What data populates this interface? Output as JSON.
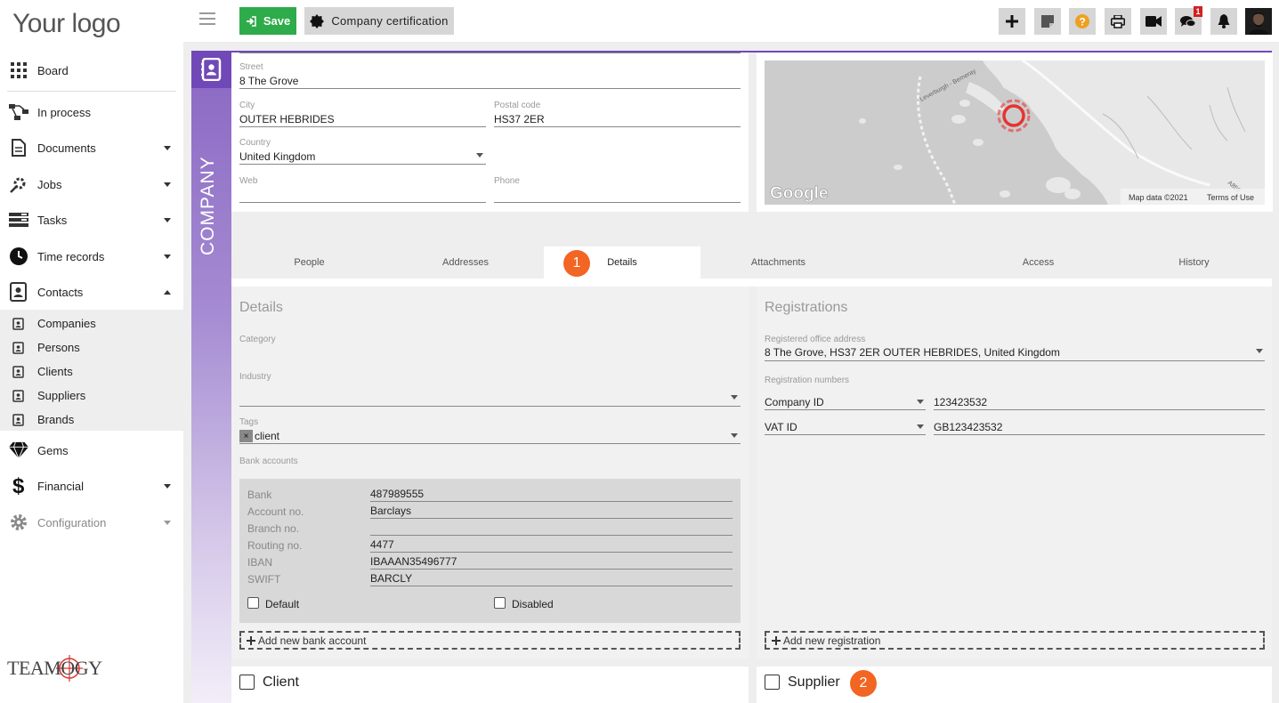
{
  "sidebar": {
    "logo": "Your logo",
    "items": [
      {
        "label": "Board"
      },
      {
        "label": "In process"
      },
      {
        "label": "Documents"
      },
      {
        "label": "Jobs"
      },
      {
        "label": "Tasks"
      },
      {
        "label": "Time records"
      },
      {
        "label": "Contacts"
      },
      {
        "label": "Gems"
      },
      {
        "label": "Financial"
      },
      {
        "label": "Configuration"
      }
    ],
    "subitems": [
      {
        "label": "Companies"
      },
      {
        "label": "Persons"
      },
      {
        "label": "Clients"
      },
      {
        "label": "Suppliers"
      },
      {
        "label": "Brands"
      }
    ],
    "brand_logo_text": "TEAMOGY"
  },
  "toolbar": {
    "save_label": "Save",
    "cert_label": "Company certification",
    "chat_badge": "1"
  },
  "strip": {
    "label": "COMPANY"
  },
  "address": {
    "street_label": "Street",
    "street": "8 The Grove",
    "city_label": "City",
    "city": "OUTER HEBRIDES",
    "postal_label": "Postal code",
    "postal": "HS37 2ER",
    "country_label": "Country",
    "country": "United Kingdom",
    "web_label": "Web",
    "web": "",
    "phone_label": "Phone",
    "phone": ""
  },
  "map": {
    "road_label": "Leverburgh - Berneray",
    "road_code": "A859",
    "google": "Google",
    "map_data": "Map data ©2021",
    "terms": "Terms of Use"
  },
  "tabs": [
    {
      "label": "People"
    },
    {
      "label": "Addresses"
    },
    {
      "label": "Details"
    },
    {
      "label": "Attachments"
    },
    {
      "label": "Access"
    },
    {
      "label": "History"
    }
  ],
  "badges": {
    "one": "1",
    "two": "2"
  },
  "details": {
    "title": "Details",
    "category_label": "Category",
    "industry_label": "Industry",
    "tags_label": "Tags",
    "tag_remove": "×",
    "tag": "client",
    "bank_accounts_label": "Bank accounts",
    "bank": {
      "rows": [
        {
          "label": "Bank",
          "value": "487989555"
        },
        {
          "label": "Account no.",
          "value": "Barclays"
        },
        {
          "label": "Branch no.",
          "value": ""
        },
        {
          "label": "Routing no.",
          "value": "4477"
        },
        {
          "label": "IBAN",
          "value": "IBAAAN35496777"
        },
        {
          "label": "SWIFT",
          "value": "BARCLY"
        }
      ],
      "default_label": "Default",
      "disabled_label": "Disabled"
    },
    "add_bank": "Add new bank account",
    "client_label": "Client"
  },
  "registrations": {
    "title": "Registrations",
    "office_label": "Registered office address",
    "office": "8 The Grove, HS37 2ER OUTER HEBRIDES, United Kingdom",
    "numbers_label": "Registration numbers",
    "rows": [
      {
        "type": "Company ID",
        "value": "123423532"
      },
      {
        "type": "VAT ID",
        "value": "GB123423532"
      }
    ],
    "add_reg": "Add new registration",
    "supplier_label": "Supplier"
  },
  "colors": {
    "accent": "#7048b8",
    "save": "#2eab4a",
    "badge": "#f26522",
    "help": "#f0a020"
  }
}
